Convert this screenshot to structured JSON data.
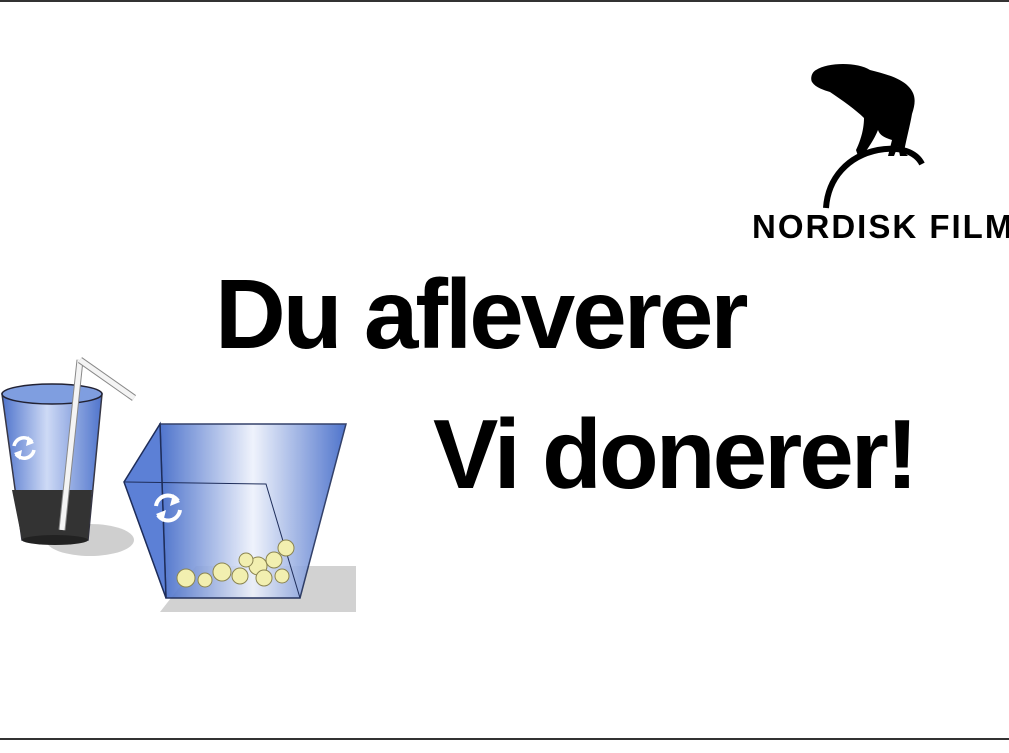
{
  "logo": {
    "text": "NORDISK FILM",
    "icon": "polar-bear-icon"
  },
  "headline": {
    "line1": "Du afleverer",
    "line2": "Vi donerer!"
  },
  "illustration": {
    "cup_icon": "recycle-icon",
    "bin_icon": "recycle-icon"
  },
  "colors": {
    "text": "#000000",
    "blue": "#3d66c7",
    "light_blue": "#b8c9f0",
    "popcorn": "#f2efb0",
    "shadow": "#cfcfcf",
    "drink": "#333333"
  }
}
